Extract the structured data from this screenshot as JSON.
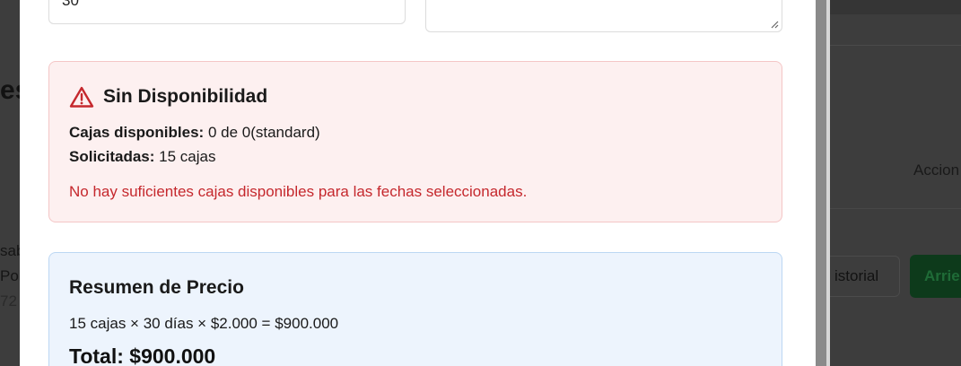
{
  "background": {
    "left_title_fragment": "es",
    "left_rows": [
      "sab",
      "Pob",
      "72"
    ],
    "acciones_header": "Accion",
    "historial_button": "istorial",
    "arrendar_button": "Arrie"
  },
  "form": {
    "days_value": "30"
  },
  "availability_alert": {
    "icon": "warning-triangle-icon",
    "title": "Sin Disponibilidad",
    "available_label": "Cajas disponibles:",
    "available_value": "0 de 0(standard)",
    "requested_label": "Solicitadas:",
    "requested_value": "15 cajas",
    "message": "No hay suficientes cajas disponibles para las fechas seleccionadas.",
    "colors": {
      "background": "#fdf0f0",
      "border": "#f4c6c6",
      "accent": "#c5282d"
    }
  },
  "price_summary": {
    "title": "Resumen de Precio",
    "calculation": "15 cajas × 30 días × $2.000 = $900.000",
    "total": "Total: $900.000",
    "colors": {
      "background": "#edf4fd",
      "border": "#bcd7f3"
    }
  }
}
